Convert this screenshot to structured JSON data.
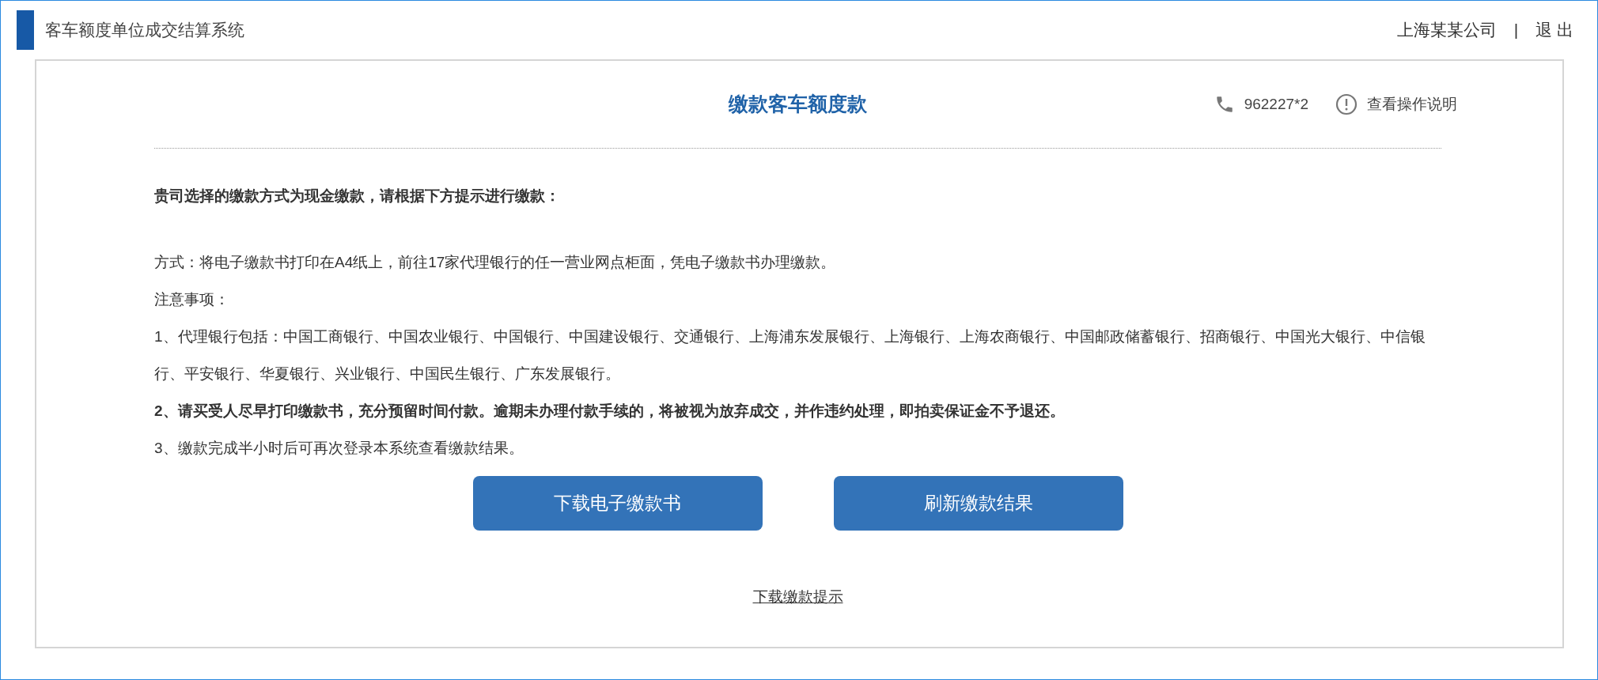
{
  "header": {
    "title": "客车额度单位成交结算系统",
    "company": "上海某某公司",
    "separator": "|",
    "logout": "退 出"
  },
  "panel": {
    "title": "缴款客车额度款",
    "hotline": "962227*2",
    "help_link": "查看操作说明",
    "intro": "贵司选择的缴款方式为现金缴款，请根据下方提示进行缴款：",
    "paragraphs": [
      {
        "kind": "plain",
        "text": "方式：将电子缴款书打印在A4纸上，前往17家代理银行的任一营业网点柜面，凭电子缴款书办理缴款。"
      },
      {
        "kind": "plain",
        "text": "注意事项："
      },
      {
        "kind": "plain",
        "text": "1、代理银行包括：中国工商银行、中国农业银行、中国银行、中国建设银行、交通银行、上海浦东发展银行、上海银行、上海农商银行、中国邮政储蓄银行、招商银行、中国光大银行、中信银行、平安银行、华夏银行、兴业银行、中国民生银行、广东发展银行。"
      },
      {
        "kind": "warning",
        "text": "2、请买受人尽早打印缴款书，充分预留时间付款。逾期未办理付款手续的，将被视为放弃成交，并作违约处理，即拍卖保证金不予退还。"
      },
      {
        "kind": "plain",
        "text": "3、缴款完成半小时后可再次登录本系统查看缴款结果。"
      }
    ],
    "buttons": [
      "下载电子缴款书",
      "刷新缴款结果"
    ],
    "footer_link": "下载缴款提示"
  }
}
